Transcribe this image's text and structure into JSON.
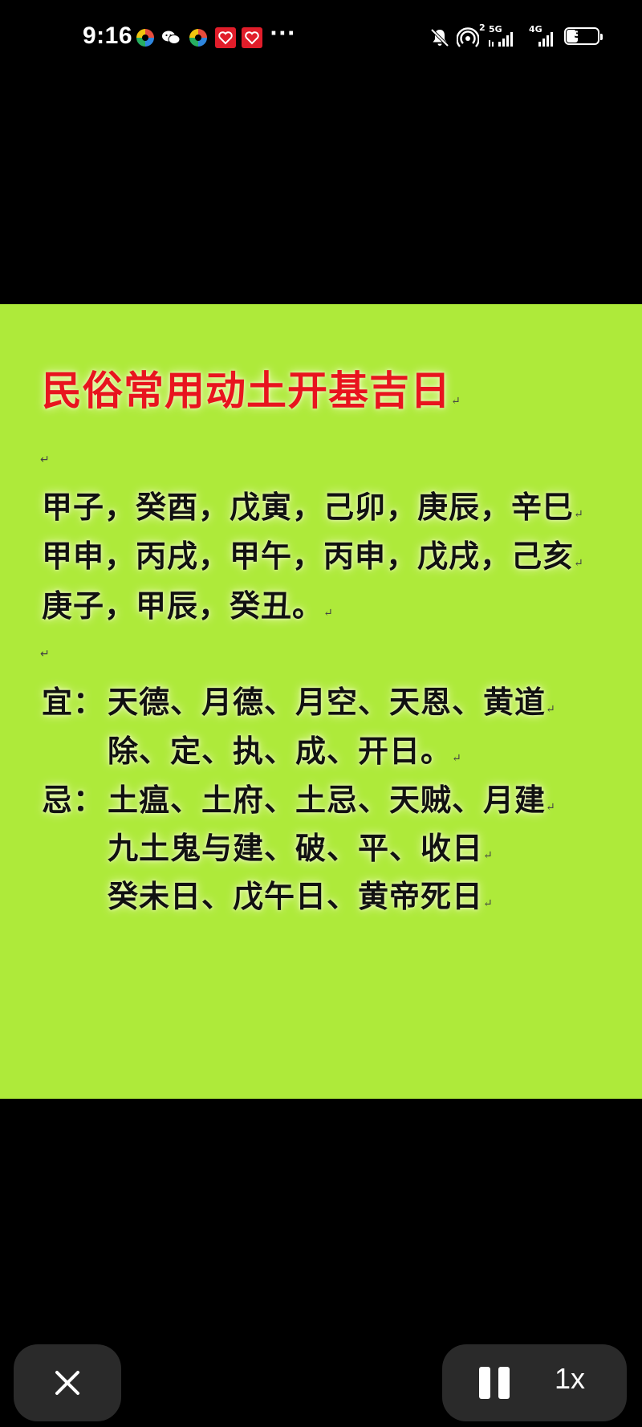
{
  "status_bar": {
    "time": "9:16",
    "more": "···",
    "network_5g": "5G",
    "network_4g": "4G",
    "sim_index": "2",
    "battery": "36"
  },
  "document": {
    "title": "民俗常用动土开基吉日",
    "para_mark": "↵",
    "days": [
      "甲子，癸酉，戊寅，己卯，庚辰，辛巳",
      "甲申，丙戌，甲午，丙申，戊戌，己亥",
      "庚子，甲辰，癸丑。"
    ],
    "yi_label": "宜：",
    "yi_lines": [
      "天德、月德、月空、天恩、黄道",
      "除、定、执、成、开日。"
    ],
    "ji_label": "忌：",
    "ji_lines": [
      "土瘟、土府、土忌、天贼、月建",
      "九土鬼与建、破、平、收日",
      "癸未日、戊午日、黄帝死日"
    ]
  },
  "controls": {
    "speed": "1x"
  }
}
